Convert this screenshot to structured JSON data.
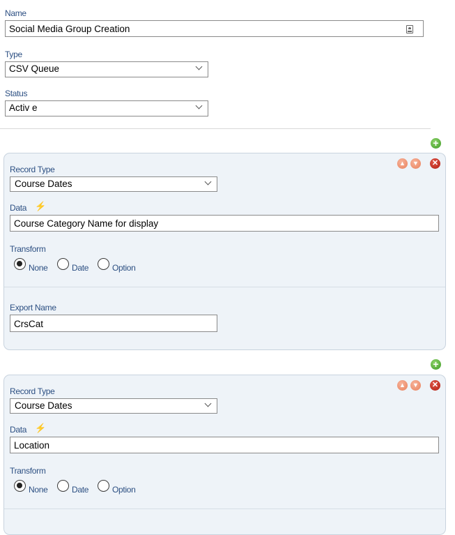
{
  "form": {
    "name": {
      "label": "Name",
      "value": "Social Media Group Creation",
      "icon": "contact-card-icon"
    },
    "type": {
      "label": "Type",
      "value": "CSV Queue"
    },
    "status": {
      "label": "Status",
      "value": "Activ e"
    }
  },
  "records": [
    {
      "record_type_label": "Record Type",
      "record_type_value": "Course Dates",
      "data_label": "Data",
      "data_value": "Course Category Name for display",
      "transform_label": "Transform",
      "transform_options": [
        "None",
        "Date",
        "Option"
      ],
      "transform_selected": "None",
      "export_name_label": "Export Name",
      "export_name_value": "CrsCat"
    },
    {
      "record_type_label": "Record Type",
      "record_type_value": "Course Dates",
      "data_label": "Data",
      "data_value": "Location",
      "transform_label": "Transform",
      "transform_options": [
        "None",
        "Date",
        "Option"
      ],
      "transform_selected": "None"
    }
  ],
  "icons": {
    "add": "add-icon",
    "remove": "remove-icon",
    "move_up": "move-up-icon",
    "move_down": "move-down-icon",
    "data_lookup": "lightning-icon"
  },
  "colors": {
    "label": "#2c4f82",
    "panel_bg": "#eef3f8",
    "add_green": "#3c9a24",
    "remove_red": "#b01c10",
    "arrow_orange": "#e9805a"
  }
}
